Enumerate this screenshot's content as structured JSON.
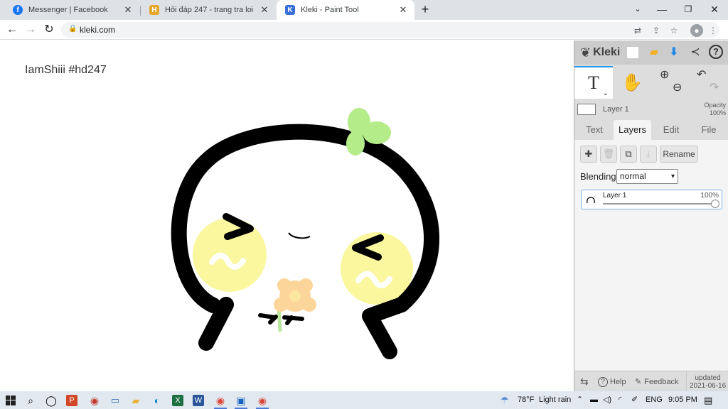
{
  "browser": {
    "tabs": [
      {
        "title": "Messenger | Facebook",
        "favicon": "facebook-icon",
        "active": false
      },
      {
        "title": "Hỏi đáp 247 - trang tra loi",
        "favicon": "hoidap-icon",
        "active": false
      },
      {
        "title": "Kleki - Paint Tool",
        "favicon": "kleki-icon",
        "active": true
      }
    ],
    "url": "kleki.com"
  },
  "canvas": {
    "text": "IamShiii #hd247"
  },
  "kleki": {
    "brand": "Kleki",
    "layer_preview": {
      "name": "Layer 1",
      "opacity_label": "Opacity",
      "opacity_value": "100%"
    },
    "tabs": [
      "Text",
      "Layers",
      "Edit",
      "File"
    ],
    "active_tab": "Layers",
    "buttons": {
      "rename": "Rename"
    },
    "blending": {
      "label": "Blending",
      "value": "normal"
    },
    "layers": [
      {
        "name": "Layer 1",
        "opacity": "100%"
      }
    ],
    "footer": {
      "help": "Help",
      "feedback": "Feedback",
      "updated_label": "updated",
      "updated_date": "2021-06-16"
    }
  },
  "taskbar": {
    "weather_temp": "78°F",
    "weather_desc": "Light rain",
    "language": "ENG",
    "time": "9:05 PM"
  },
  "colors": {
    "accent": "#2196f3",
    "taskbar_bg": "#e1e8f0",
    "tab_bg": "#dee1e6"
  }
}
